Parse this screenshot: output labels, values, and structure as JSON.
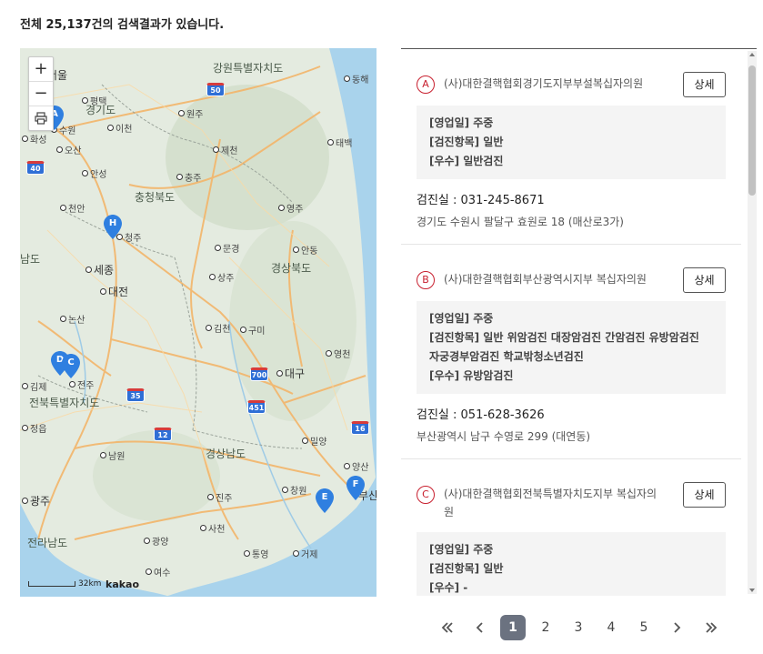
{
  "summary": "전체 25,137건의 검색결과가 있습니다.",
  "map": {
    "zoom_in": "+",
    "zoom_out": "−",
    "print_icon": "printer-icon",
    "scale_label": "32km",
    "brand": "kakao",
    "places": [
      {
        "name": "강원특별자치도",
        "type": "prov"
      },
      {
        "name": "서울",
        "type": "big"
      },
      {
        "name": "경기도",
        "type": "prov"
      },
      {
        "name": "동해",
        "type": "dot"
      },
      {
        "name": "원주",
        "type": "dot"
      },
      {
        "name": "평택",
        "type": "dot"
      },
      {
        "name": "수원",
        "type": "dot"
      },
      {
        "name": "이천",
        "type": "dot"
      },
      {
        "name": "화성",
        "type": "dot"
      },
      {
        "name": "오산",
        "type": "dot"
      },
      {
        "name": "제천",
        "type": "dot"
      },
      {
        "name": "태백",
        "type": "dot"
      },
      {
        "name": "안성",
        "type": "dot"
      },
      {
        "name": "충주",
        "type": "dot"
      },
      {
        "name": "충청북도",
        "type": "prov"
      },
      {
        "name": "천안",
        "type": "dot"
      },
      {
        "name": "영주",
        "type": "dot"
      },
      {
        "name": "청주",
        "type": "dot"
      },
      {
        "name": "문경",
        "type": "dot"
      },
      {
        "name": "안동",
        "type": "dot"
      },
      {
        "name": "남도",
        "type": "prov"
      },
      {
        "name": "세종",
        "type": "big"
      },
      {
        "name": "경상북도",
        "type": "prov"
      },
      {
        "name": "대전",
        "type": "big"
      },
      {
        "name": "상주",
        "type": "dot"
      },
      {
        "name": "논산",
        "type": "dot"
      },
      {
        "name": "김천",
        "type": "dot"
      },
      {
        "name": "구미",
        "type": "dot"
      },
      {
        "name": "영천",
        "type": "dot"
      },
      {
        "name": "대구",
        "type": "big"
      },
      {
        "name": "전주",
        "type": "dot"
      },
      {
        "name": "김제",
        "type": "dot"
      },
      {
        "name": "전북특별자치도",
        "type": "prov"
      },
      {
        "name": "정읍",
        "type": "dot"
      },
      {
        "name": "밀양",
        "type": "dot"
      },
      {
        "name": "남원",
        "type": "dot"
      },
      {
        "name": "경상남도",
        "type": "prov"
      },
      {
        "name": "양산",
        "type": "dot"
      },
      {
        "name": "광주",
        "type": "big"
      },
      {
        "name": "진주",
        "type": "dot"
      },
      {
        "name": "창원",
        "type": "dot"
      },
      {
        "name": "부산",
        "type": "big"
      },
      {
        "name": "사천",
        "type": "dot"
      },
      {
        "name": "전라남도",
        "type": "prov"
      },
      {
        "name": "광양",
        "type": "dot"
      },
      {
        "name": "통영",
        "type": "dot"
      },
      {
        "name": "거제",
        "type": "dot"
      },
      {
        "name": "여수",
        "type": "dot"
      }
    ],
    "highways": [
      "50",
      "40",
      "35",
      "700",
      "451",
      "12",
      "16"
    ],
    "markers": [
      "A",
      "H",
      "D",
      "C",
      "E",
      "F"
    ],
    "marker_color": "#2f7fe0"
  },
  "results": [
    {
      "marker": "A",
      "name": "(사)대한결핵협회경기도지부부설복십자의원",
      "detail_label": "상세",
      "lines": [
        "[영업일] 주중",
        "[검진항목] 일반",
        "[우수] 일반검진"
      ],
      "phone": "검진실 :  031-245-8671",
      "address": "경기도 수원시 팔달구 효원로 18 (매산로3가)"
    },
    {
      "marker": "B",
      "name": "(사)대한결핵협회부산광역시지부 복십자의원",
      "detail_label": "상세",
      "lines": [
        "[영업일] 주중",
        "[검진항목] 일반 위암검진 대장암검진 간암검진 유방암검진 자궁경부암검진 학교밖청소년검진",
        "[우수] 유방암검진"
      ],
      "phone": "검진실 :  051-628-3626",
      "address": "부산광역시 남구 수영로 299 (대연동)"
    },
    {
      "marker": "C",
      "name": "(사)대한결핵협회전북특별자치도지부 복십자의원",
      "detail_label": "상세",
      "lines": [
        "[영업일] 주중",
        "[검진항목] 일반",
        "[우수] -"
      ],
      "phone": "",
      "address": ""
    }
  ],
  "pagination": {
    "pages": [
      "1",
      "2",
      "3",
      "4",
      "5"
    ],
    "active": "1",
    "first_icon": "double-chevron-left-icon",
    "prev_icon": "chevron-left-icon",
    "next_icon": "chevron-right-icon",
    "last_icon": "double-chevron-right-icon"
  },
  "colors": {
    "badge": "#c8202f",
    "active_page": "#6b7280",
    "sea": "#a9d3ec",
    "land": "#e6ece1"
  }
}
